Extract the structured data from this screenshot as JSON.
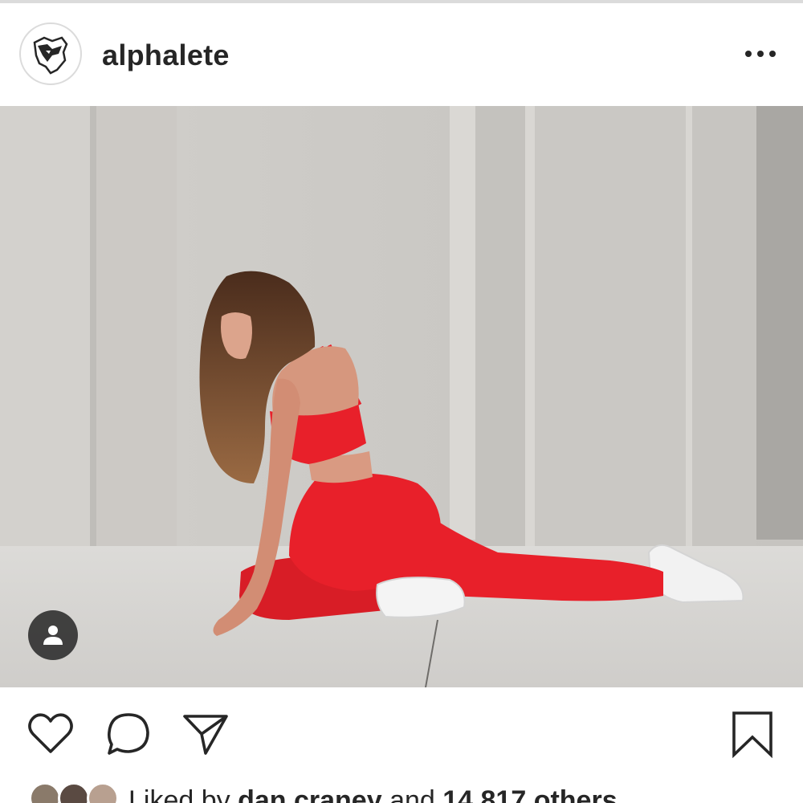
{
  "post": {
    "username": "alphalete",
    "avatar_icon": "wolf-logo-icon",
    "more_icon": "more-options-icon"
  },
  "photo": {
    "alt_icon": "photo",
    "tag_icon": "user-tag-icon"
  },
  "actions": {
    "like_icon": "heart-icon",
    "comment_icon": "comment-bubble-icon",
    "share_icon": "paper-plane-icon",
    "save_icon": "bookmark-icon"
  },
  "likes": {
    "prefix": "Liked by ",
    "user": "dan.craney",
    "middle": " and ",
    "count_text": "14,817 others"
  },
  "colors": {
    "text": "#262626",
    "border": "#dbdbdb",
    "outfit_red": "#e8202a"
  }
}
